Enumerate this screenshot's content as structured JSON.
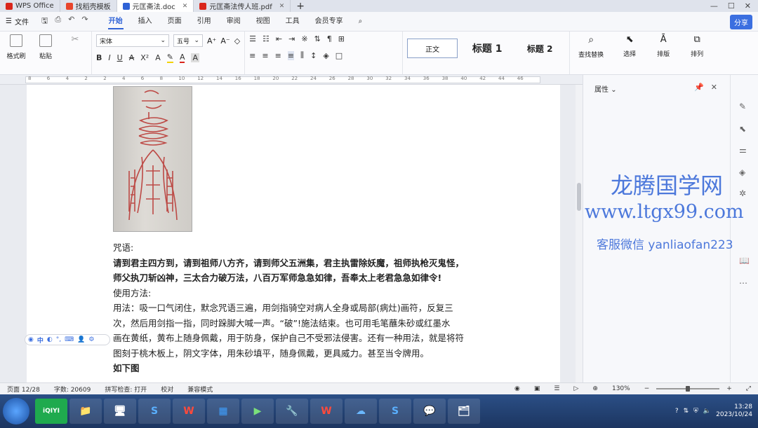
{
  "tabs": [
    {
      "label": "WPS Office",
      "color": "#d9261c"
    },
    {
      "label": "找稻壳模板",
      "color": "#e8452c"
    },
    {
      "label": "元匡斋法.doc",
      "color": "#2f62d6"
    },
    {
      "label": "元匡斋法传人班.pdf",
      "color": "#d9261c"
    }
  ],
  "menubar": {
    "file": "文件",
    "items": [
      "开始",
      "插入",
      "页面",
      "引用",
      "审阅",
      "视图",
      "工具",
      "会员专享"
    ],
    "active_index": 0,
    "share": "分享"
  },
  "ribbon": {
    "format_painter": "格式刷",
    "paste": "粘贴",
    "font_name": "宋体",
    "font_size": "五号",
    "styles": [
      "正文",
      "标题 1",
      "标题 2"
    ],
    "find": "查找替换",
    "select": "选择",
    "layout": "排版",
    "arrange": "排列"
  },
  "ruler": [
    "8",
    "6",
    "4",
    "2",
    "2",
    "4",
    "6",
    "8",
    "10",
    "12",
    "14",
    "16",
    "18",
    "20",
    "22",
    "24",
    "26",
    "28",
    "30",
    "32",
    "34",
    "36",
    "38",
    "40",
    "42",
    "44",
    "46"
  ],
  "document": {
    "line_incantation_label": "咒语:",
    "incantation_line1": "请到君主四方到，请到祖师八方齐，请到师父五洲集，君主执雷除妖魔，祖师执枪灭鬼怪，",
    "incantation_line2": "师父执刀斩凶神，三太合力破万法，八百万军师急急如律，吾奉太上老君急急如律令!",
    "usage_label": "使用方法:",
    "usage_line1": "用法：吸一口气闭住，默念咒语三遍，用剑指骑空对病人全身或局部(病灶)画符，反复三",
    "usage_line2": "次，然后用剑指一指，同时跺脚大喊一声。“破”!施法结束。也可用毛笔蘸朱砂或红墨水",
    "usage_line3": "画在黄纸，黄布上随身佩戴，用于防身，保护自己不受邪法侵害。还有一种用法，就是将符",
    "usage_line4": "图刻于桃木板上，阴文字体，用朱砂填平，随身佩戴，更具威力。甚至当令牌用。",
    "figure_label": "如下图"
  },
  "floatbar": "中",
  "panel": {
    "title": "属性"
  },
  "watermark": {
    "line1": "龙腾国学网",
    "line2": "www.ltgx99.com",
    "line3": "客服微信 yanliaofan223"
  },
  "status": {
    "page": "页面 12/28",
    "words": "字数: 20609",
    "spell": "拼写检查: 打开",
    "proof": "校对",
    "compat": "兼容模式",
    "zoom": "130%"
  },
  "taskbar": {
    "time": "13:28",
    "date": "2023/10/24",
    "iqiyi": "iQIYI"
  }
}
